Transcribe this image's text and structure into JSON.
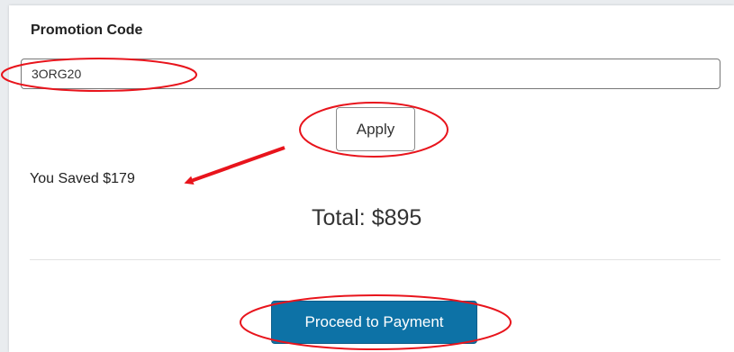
{
  "promotion": {
    "label": "Promotion Code",
    "code_value": "3ORG20",
    "apply_label": "Apply"
  },
  "summary": {
    "saved_text": "You Saved $179",
    "total_text": "Total: $895"
  },
  "checkout": {
    "pay_label": "Proceed to Payment"
  },
  "colors": {
    "pay_button": "#0d72a6",
    "annotation": "#e8141c"
  }
}
